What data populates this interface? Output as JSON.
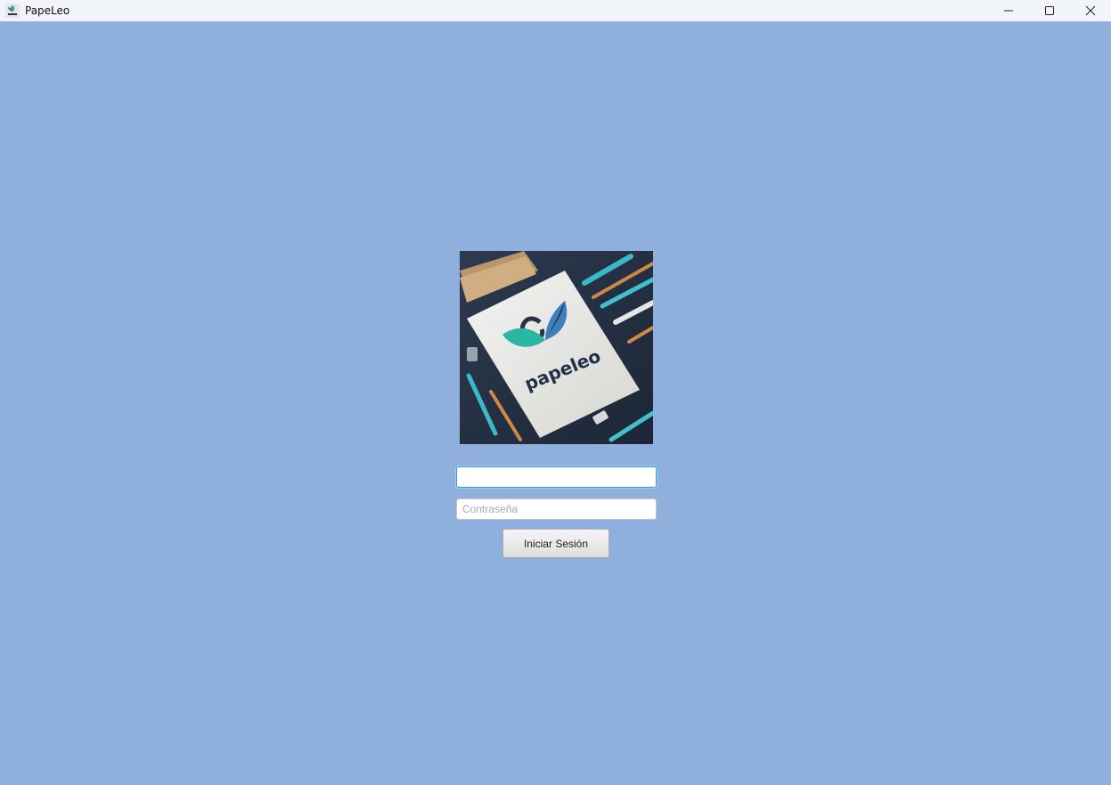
{
  "window": {
    "title": "PapeLeo",
    "icon": "papeleo-app-icon",
    "controls": [
      "minimize-icon",
      "maximize-icon",
      "close-icon"
    ],
    "background_color": "#8fb0dc"
  },
  "logo": {
    "brand_text": "papeleo",
    "alt": "papeleo logo"
  },
  "login": {
    "username_value": "",
    "username_placeholder": "",
    "password_value": "",
    "password_placeholder": "Contraseña",
    "submit_label": "Iniciar Sesión"
  }
}
